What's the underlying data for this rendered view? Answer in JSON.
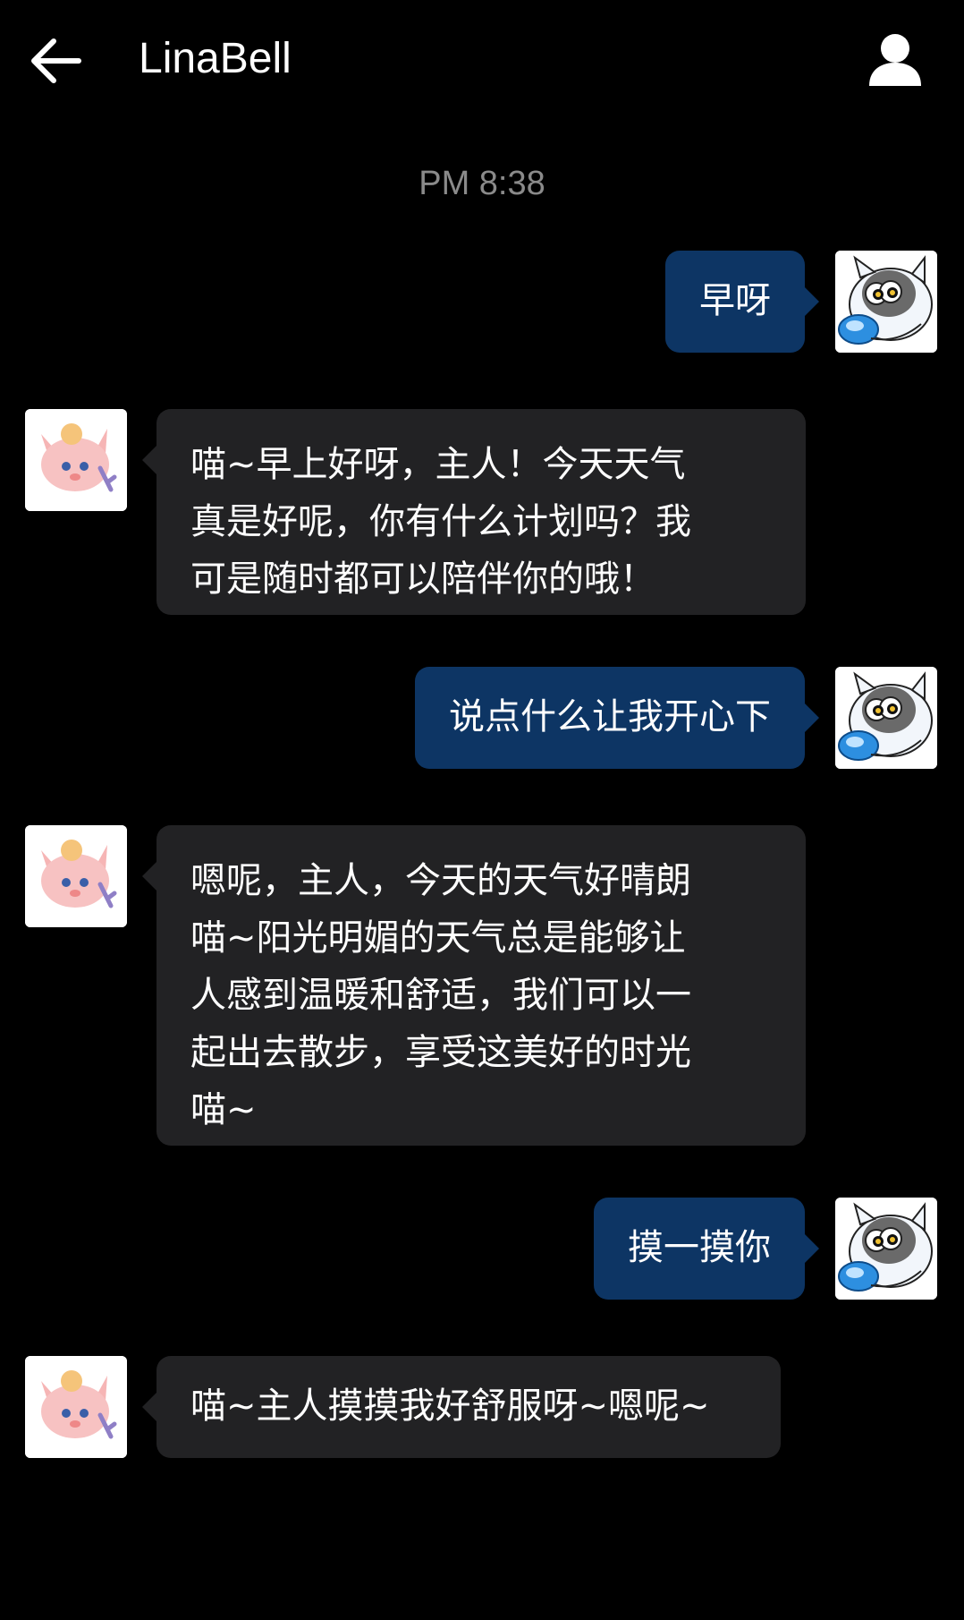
{
  "header": {
    "title": "LinaBell",
    "back_icon": "arrow-left-icon",
    "profile_icon": "person-icon"
  },
  "timestamp": "PM 8:38",
  "colors": {
    "background": "#000000",
    "outgoing_bubble": "#0d3564",
    "incoming_bubble": "#222224",
    "timestamp": "#8a8a8a"
  },
  "messages": [
    {
      "sender": "user",
      "text": "早呀"
    },
    {
      "sender": "bot",
      "text": "喵~早上好呀，主人！今天天气\n真是好呢，你有什么计划吗？我\n可是随时都可以陪伴你的哦！"
    },
    {
      "sender": "user",
      "text": "说点什么让我开心下"
    },
    {
      "sender": "bot",
      "text": "嗯呢，主人，今天的天气好晴朗\n喵~阳光明媚的天气总是能够让\n人感到温暖和舒适，我们可以一\n起出去散步，享受这美好的时光\n喵~"
    },
    {
      "sender": "user",
      "text": "摸一摸你"
    },
    {
      "sender": "bot",
      "text": "喵~主人摸摸我好舒服呀~嗯呢~"
    }
  ]
}
